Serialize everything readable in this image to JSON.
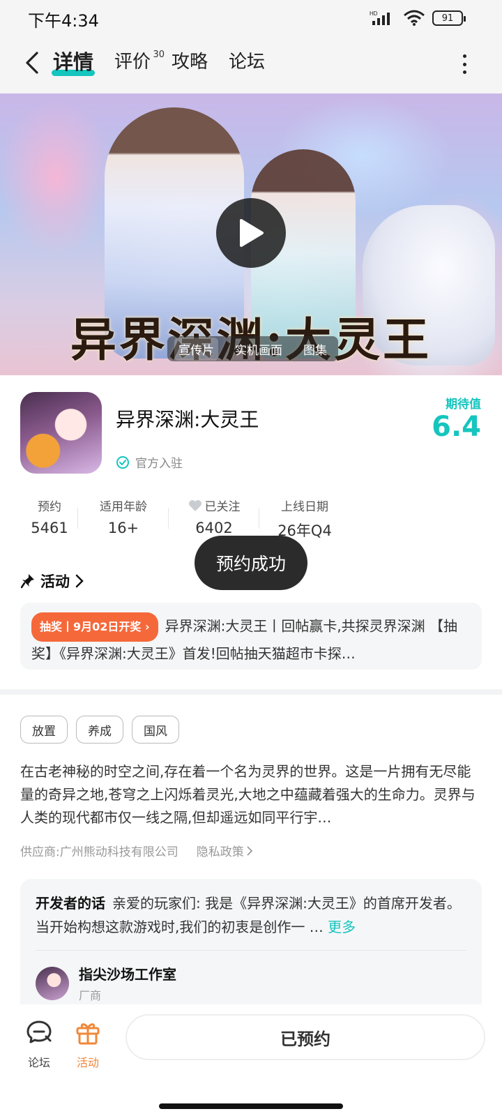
{
  "status": {
    "time": "下午4:34",
    "battery": "91",
    "network": "HD"
  },
  "nav": {
    "tabs": [
      {
        "label": "详情",
        "active": true
      },
      {
        "label": "评价",
        "badge": "30"
      },
      {
        "label": "攻略"
      },
      {
        "label": "论坛"
      }
    ]
  },
  "hero": {
    "title_art": "异界深渊:大灵王",
    "media_tabs": [
      {
        "label": "宣传片",
        "active": true
      },
      {
        "label": "实机画面"
      },
      {
        "label": "图集"
      }
    ]
  },
  "game": {
    "title": "异界深渊:大灵王",
    "official": "官方入驻",
    "expect_label": "期待值",
    "expect_value": "6.4"
  },
  "stats": [
    {
      "label": "预约",
      "value": "5461"
    },
    {
      "label": "适用年龄",
      "value": "16+"
    },
    {
      "label": "已关注",
      "value": "6402"
    },
    {
      "label": "上线日期",
      "value": "26年Q4"
    }
  ],
  "toast": "预约成功",
  "activity": {
    "heading": "活动",
    "badge": "抽奖丨9月02日开奖",
    "text": "异界深渊:大灵王丨回帖赢卡,共探灵界深渊 【抽奖】《异界深渊:大灵王》首发!回帖抽天猫超市卡探…"
  },
  "tags": [
    "放置",
    "养成",
    "国风"
  ],
  "description": "在古老神秘的时空之间,存在着一个名为灵界的世界。这是一片拥有无尽能量的奇异之地,苍穹之上闪烁着灵光,大地之中蕴藏着强大的生命力。灵界与人类的现代都市仅一线之隔,但却遥远如同平行宇…",
  "supplier": "供应商:广州熊动科技有限公司",
  "privacy": "隐私政策",
  "developer": {
    "label": "开发者的话",
    "text": "亲爱的玩家们: 我是《异界深渊:大灵王》的首席开发者。当开始构想这款游戏时,我们的初衷是创作一 …",
    "more": "更多",
    "studio_name": "指尖沙场工作室",
    "studio_role": "厂商"
  },
  "bottom": {
    "forum": "论坛",
    "activity": "活动",
    "reserved": "已预约"
  },
  "colors": {
    "accent": "#15c5be",
    "orange": "#f5683a"
  }
}
